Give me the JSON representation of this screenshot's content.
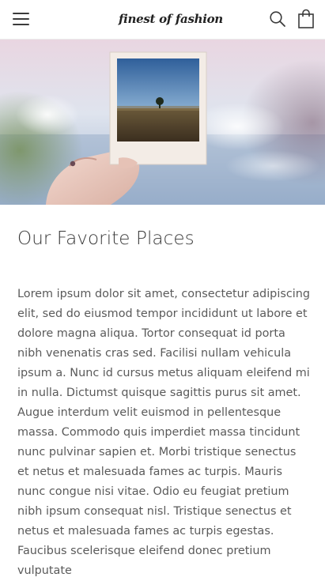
{
  "header": {
    "menu_icon": "hamburger-menu-icon",
    "logo_text": "finest of fashion",
    "search_icon": "search-icon",
    "cart_icon": "shopping-bag-icon"
  },
  "hero": {
    "image_description_icon": "hand-holding-polaroid-photo"
  },
  "article": {
    "title": "Our Favorite Places",
    "body": "Lorem ipsum dolor sit amet, consectetur adipiscing elit, sed do eiusmod tempor incididunt ut labore et dolore magna aliqua. Tortor consequat id porta nibh venenatis cras sed. Facilisi nullam vehicula ipsum a. Nunc id cursus metus aliquam eleifend mi in nulla. Dictumst quisque sagittis purus sit amet. Augue interdum velit euismod in pellentesque massa. Commodo quis imperdiet massa tincidunt nunc pulvinar sapien et. Morbi tristique senectus et netus et malesuada fames ac turpis. Mauris nunc congue nisi vitae. Odio eu feugiat pretium nibh ipsum consequat nisl. Tristique senectus et netus et malesuada fames ac turpis egestas. Faucibus scelerisque eleifend donec pretium vulputate"
  },
  "colors": {
    "text_primary": "#3a3a3a",
    "text_body": "#5a5a5a",
    "background": "#ffffff"
  }
}
